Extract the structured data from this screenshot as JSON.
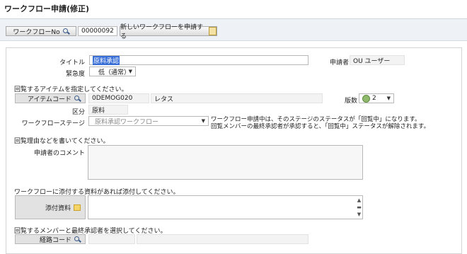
{
  "page": {
    "title": "ワークフロー申請(修正)"
  },
  "toolbar": {
    "workflow_no_button": "ワークフローNo",
    "workflow_no_value": "00000092",
    "new_workflow_button": "新しいワークフローを申請する"
  },
  "form": {
    "title_label": "タイトル",
    "title_value": "原料承認",
    "applicant_label": "申請者",
    "applicant_value": "OU ユーザー",
    "urgency_label": "緊急度",
    "urgency_value": "低（通常）",
    "item_section": "回覧するアイテムを指定してください。",
    "item_code_button": "アイテムコード",
    "item_code_value": "0DEMOG020",
    "item_name_value": "レタス",
    "version_label": "版数",
    "version_value": "2",
    "category_label": "区分",
    "category_value": "原料",
    "stage_label": "ワークフローステージ",
    "stage_value": "原料承認ワークフロー",
    "stage_note_line1": "ワークフロー申請中は、そのステージのステータスが「回覧中」になります。",
    "stage_note_line2": "回覧メンバーの最終承認者が承認すると、「回覧中」ステータスが解除されます。",
    "reason_section": "回覧理由などを書いてください。",
    "comment_label": "申請者のコメント",
    "comment_value": "",
    "attach_section": "ワークフローに添付する資料があれば添付してください。",
    "attach_button": "添付資料",
    "member_section": "回覧するメンバーと最終承認者を選択してください。",
    "route_code_button": "経路コード",
    "route_code_value": ""
  }
}
